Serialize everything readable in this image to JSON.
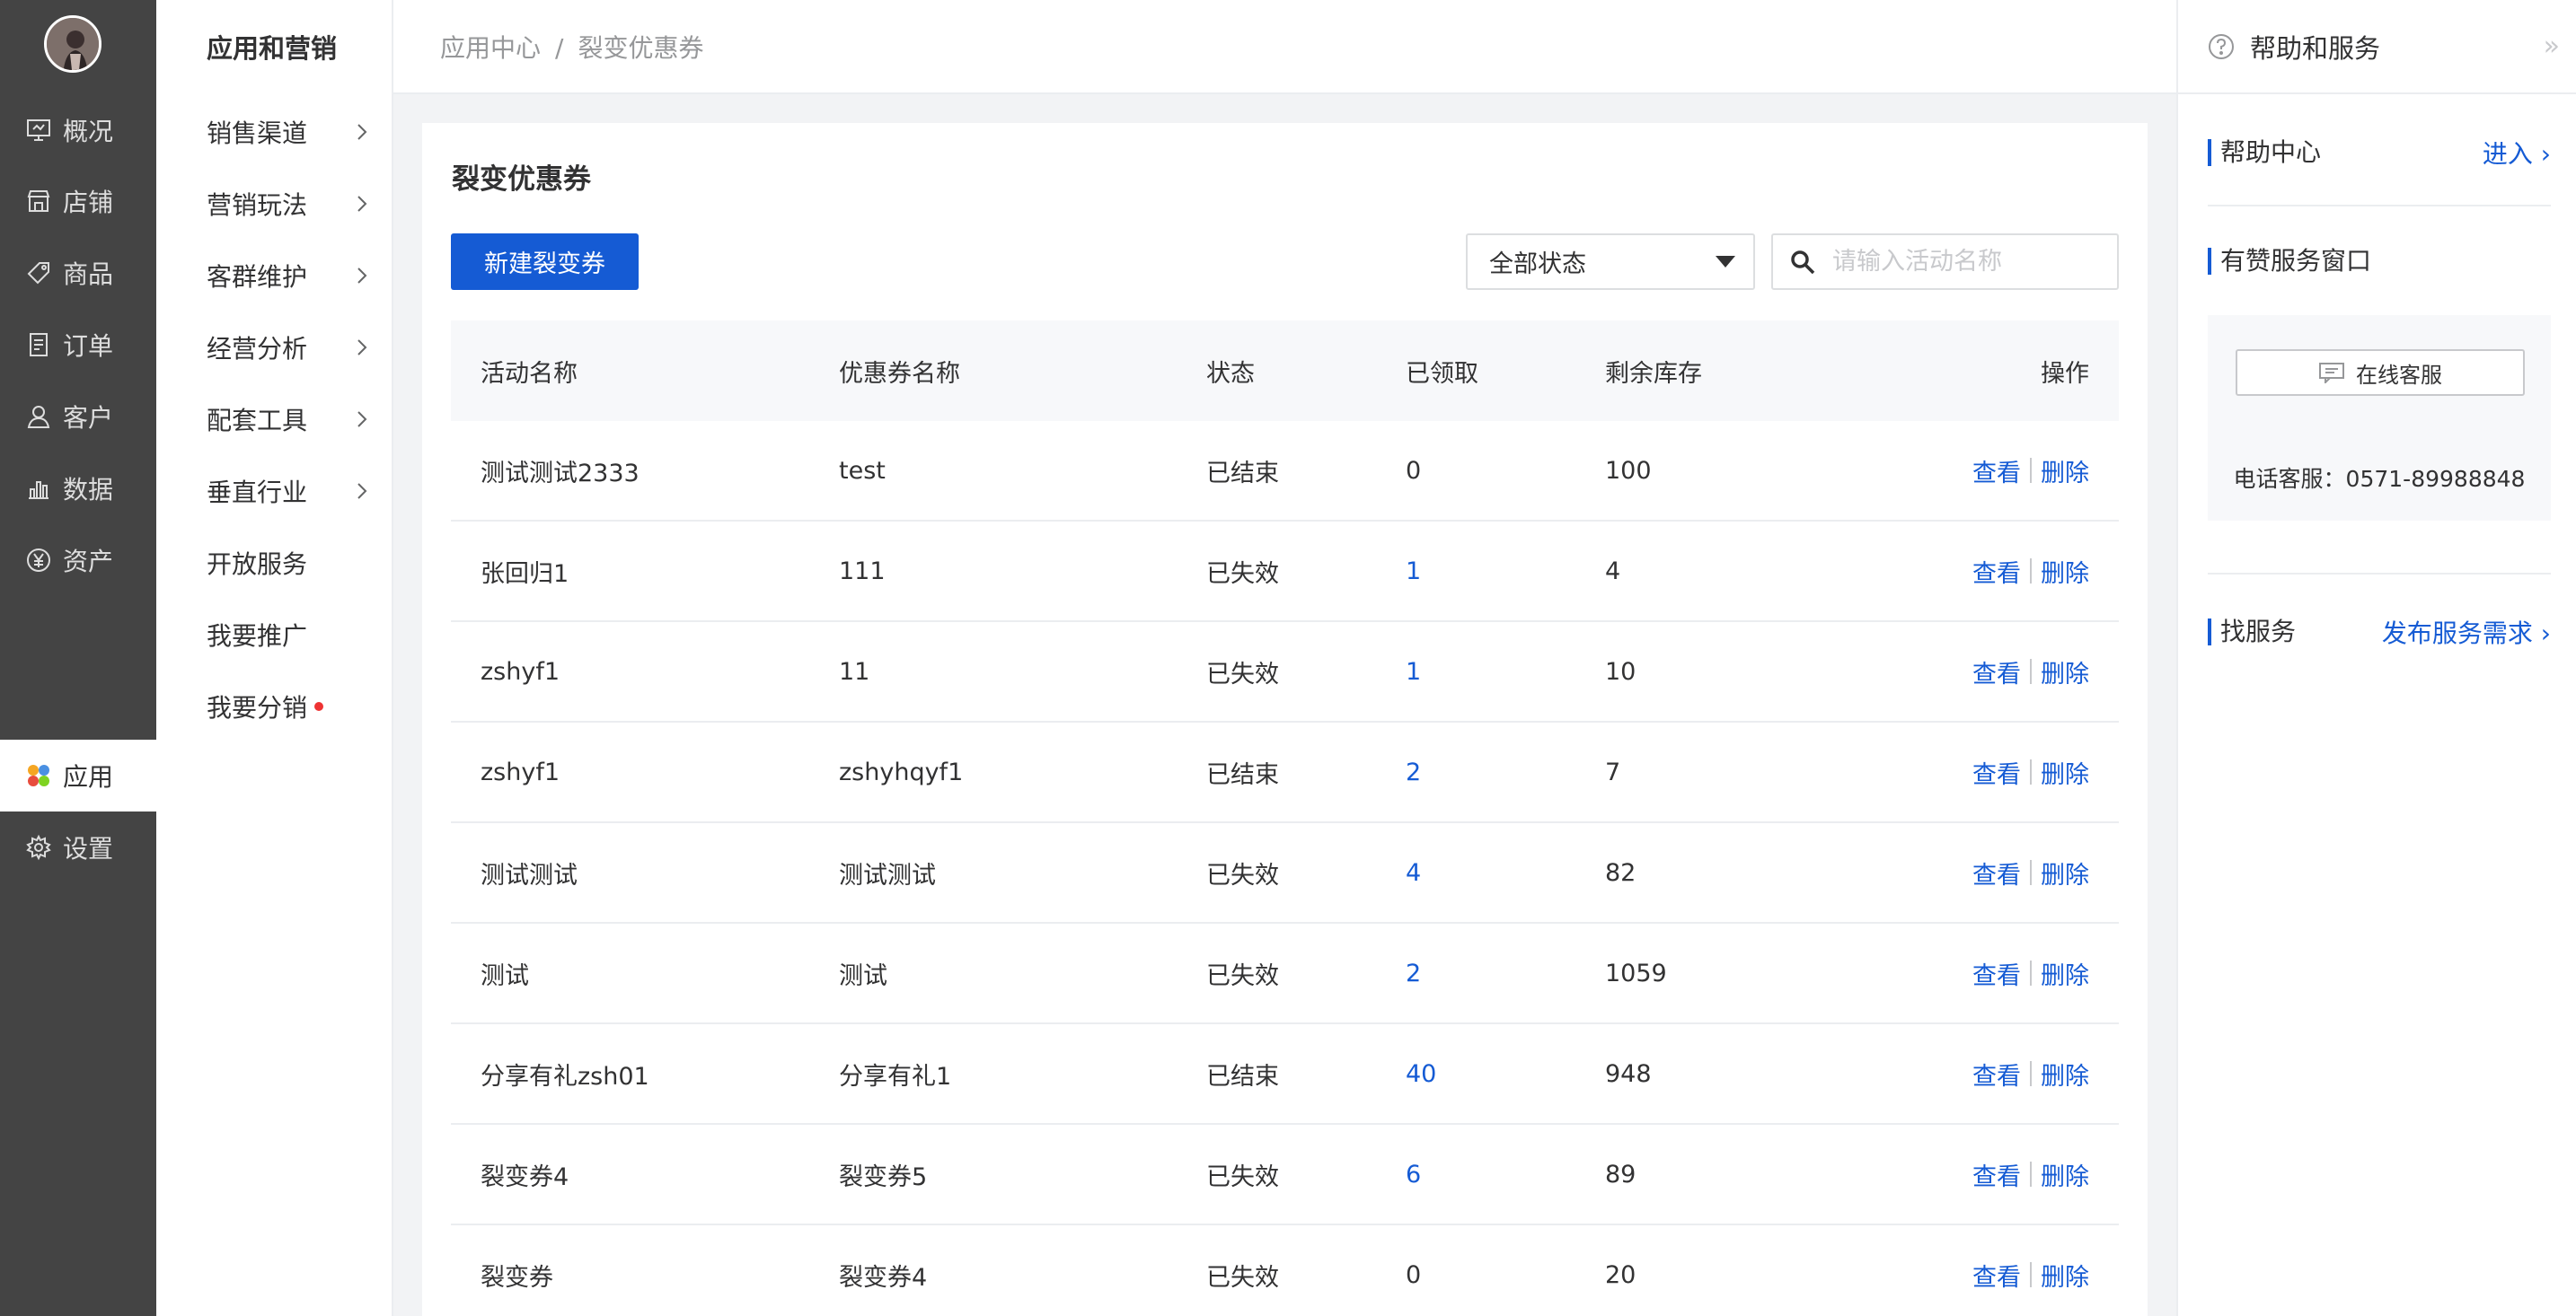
{
  "primary_nav": {
    "items": [
      {
        "label": "概况",
        "icon": "dashboard-icon"
      },
      {
        "label": "店铺",
        "icon": "store-icon"
      },
      {
        "label": "商品",
        "icon": "tag-icon"
      },
      {
        "label": "订单",
        "icon": "order-icon"
      },
      {
        "label": "客户",
        "icon": "user-icon"
      },
      {
        "label": "数据",
        "icon": "chart-icon"
      },
      {
        "label": "资产",
        "icon": "yen-icon"
      },
      {
        "label": "应用",
        "icon": "apps-icon"
      },
      {
        "label": "设置",
        "icon": "gear-icon"
      }
    ],
    "active": "应用"
  },
  "secondary_nav": {
    "title": "应用和营销",
    "items": [
      {
        "label": "销售渠道"
      },
      {
        "label": "营销玩法"
      },
      {
        "label": "客群维护"
      },
      {
        "label": "经营分析"
      },
      {
        "label": "配套工具"
      },
      {
        "label": "垂直行业"
      },
      {
        "label": "开放服务"
      },
      {
        "label": "我要推广"
      },
      {
        "label": "我要分销"
      }
    ]
  },
  "breadcrumb": {
    "parent": "应用中心",
    "separator": "/",
    "current": "裂变优惠券"
  },
  "main": {
    "title": "裂变优惠券",
    "new_button": "新建裂变券",
    "status_filter": "全部状态",
    "search_placeholder": "请输入活动名称",
    "columns": [
      "活动名称",
      "优惠券名称",
      "状态",
      "已领取",
      "剩余库存",
      "操作"
    ],
    "rows": [
      {
        "name": "测试测试2333",
        "coupon": "test",
        "status": "已结束",
        "claimed": "0",
        "stock": "100"
      },
      {
        "name": "张回归1",
        "coupon": "111",
        "status": "已失效",
        "claimed": "1",
        "stock": "4"
      },
      {
        "name": "zshyf1",
        "coupon": "11",
        "status": "已失效",
        "claimed": "1",
        "stock": "10"
      },
      {
        "name": "zshyf1",
        "coupon": "zshyhqyf1",
        "status": "已结束",
        "claimed": "2",
        "stock": "7"
      },
      {
        "name": "测试测试",
        "coupon": "测试测试",
        "status": "已失效",
        "claimed": "4",
        "stock": "82"
      },
      {
        "name": "测试",
        "coupon": "测试",
        "status": "已失效",
        "claimed": "2",
        "stock": "1059"
      },
      {
        "name": "分享有礼zsh01",
        "coupon": "分享有礼1",
        "status": "已结束",
        "claimed": "40",
        "stock": "948"
      },
      {
        "name": "裂变券4",
        "coupon": "裂变券5",
        "status": "已失效",
        "claimed": "6",
        "stock": "89"
      },
      {
        "name": "裂变券",
        "coupon": "裂变券4",
        "status": "已失效",
        "claimed": "0",
        "stock": "20"
      }
    ],
    "action_view": "查看",
    "action_delete": "删除"
  },
  "help_panel": {
    "title": "帮助和服务",
    "help_center": "帮助中心",
    "enter_link": "进入",
    "service_window": "有赞服务窗口",
    "online_service": "在线客服",
    "phone": "电话客服：0571-89988848",
    "find_service": "找服务",
    "publish_link": "发布服务需求"
  },
  "colors": {
    "accent": "#155bd4",
    "sidebar": "#444444",
    "danger_dot": "#ee3333"
  }
}
